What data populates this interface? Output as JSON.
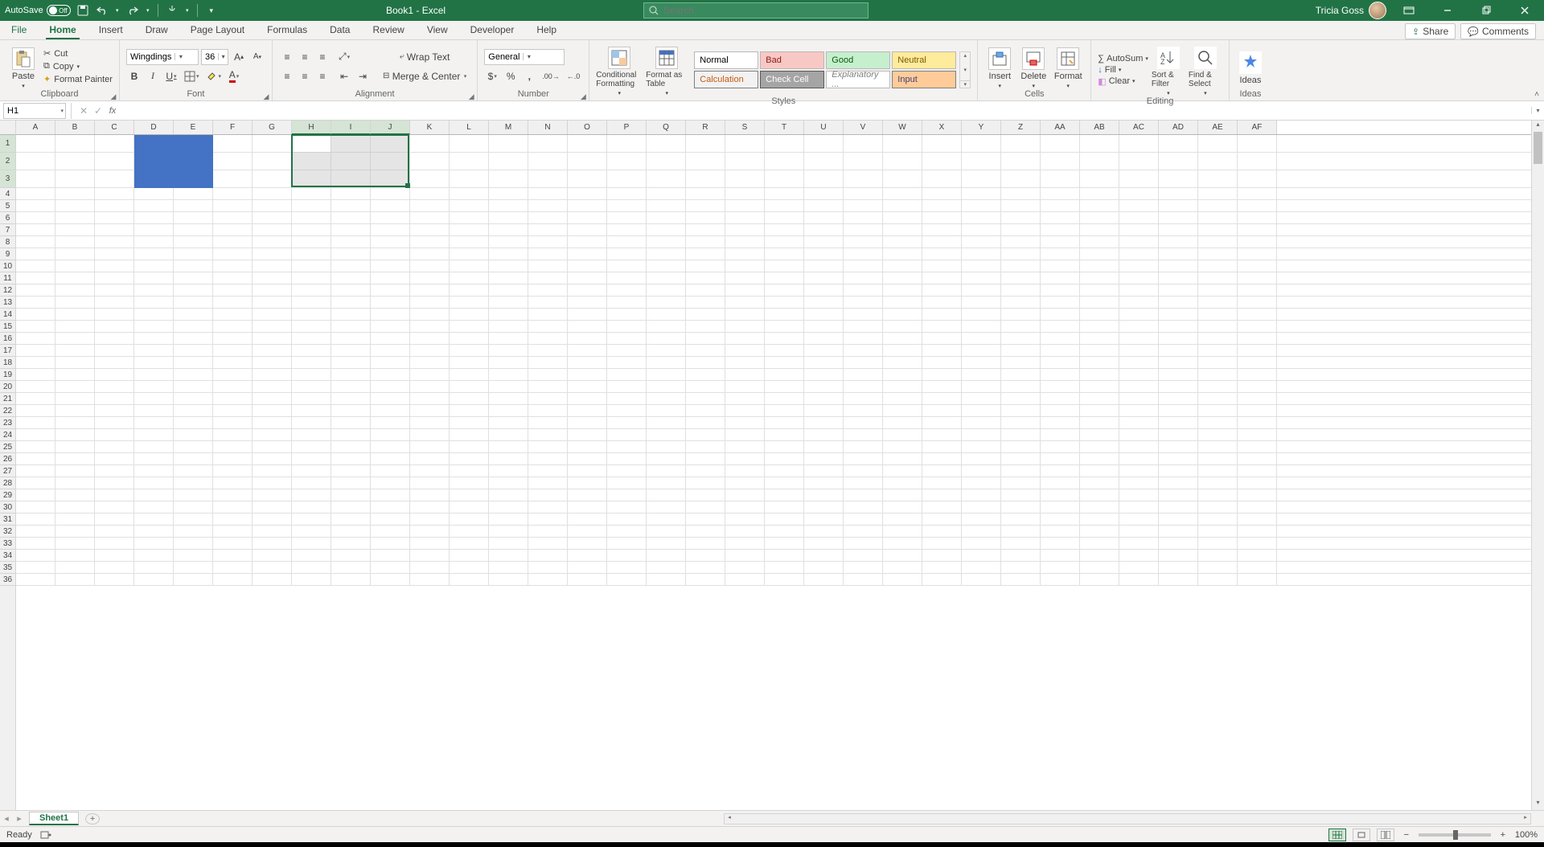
{
  "titlebar": {
    "autosave_label": "AutoSave",
    "autosave_state": "Off",
    "doc_title": "Book1  -  Excel",
    "search_placeholder": "Search",
    "user_name": "Tricia Goss"
  },
  "tabs": {
    "file": "File",
    "items": [
      "Home",
      "Insert",
      "Draw",
      "Page Layout",
      "Formulas",
      "Data",
      "Review",
      "View",
      "Developer",
      "Help"
    ],
    "active_index": 0,
    "share": "Share",
    "comments": "Comments"
  },
  "ribbon": {
    "clipboard": {
      "label": "Clipboard",
      "paste": "Paste",
      "cut": "Cut",
      "copy": "Copy",
      "format_painter": "Format Painter"
    },
    "font": {
      "label": "Font",
      "name": "Wingdings",
      "size": "36"
    },
    "alignment": {
      "label": "Alignment",
      "wrap": "Wrap Text",
      "merge": "Merge & Center"
    },
    "number": {
      "label": "Number",
      "format": "General"
    },
    "styles": {
      "label": "Styles",
      "cond": "Conditional Formatting",
      "table": "Format as Table",
      "gallery": [
        "Normal",
        "Bad",
        "Good",
        "Neutral",
        "Calculation",
        "Check Cell",
        "Explanatory ...",
        "Input"
      ]
    },
    "cells": {
      "label": "Cells",
      "insert": "Insert",
      "delete": "Delete",
      "format": "Format"
    },
    "editing": {
      "label": "Editing",
      "autosum": "AutoSum",
      "fill": "Fill",
      "clear": "Clear",
      "sort": "Sort & Filter",
      "find": "Find & Select"
    },
    "ideas": {
      "label": "Ideas",
      "btn": "Ideas"
    }
  },
  "formula_bar": {
    "name_box": "H1",
    "formula": ""
  },
  "grid": {
    "columns": [
      "A",
      "B",
      "C",
      "D",
      "E",
      "F",
      "G",
      "H",
      "I",
      "J",
      "K",
      "L",
      "M",
      "N",
      "O",
      "P",
      "Q",
      "R",
      "S",
      "T",
      "U",
      "V",
      "W",
      "X",
      "Y",
      "Z",
      "AA",
      "AB",
      "AC",
      "AD",
      "AE",
      "AF"
    ],
    "selected_cols": [
      "H",
      "I",
      "J"
    ],
    "selected_rows": [
      1,
      2,
      3
    ],
    "tall_rows": [
      1,
      2,
      3
    ],
    "row_count": 36,
    "blue_fill": {
      "cols": [
        "D",
        "E"
      ],
      "rows": [
        1,
        2,
        3
      ]
    },
    "selection": {
      "active": "H1",
      "range": "H1:J3"
    }
  },
  "sheets": {
    "active": "Sheet1"
  },
  "statusbar": {
    "status": "Ready",
    "zoom": "100%"
  },
  "colors": {
    "accent": "#217346",
    "blue_fill": "#4472c4"
  }
}
